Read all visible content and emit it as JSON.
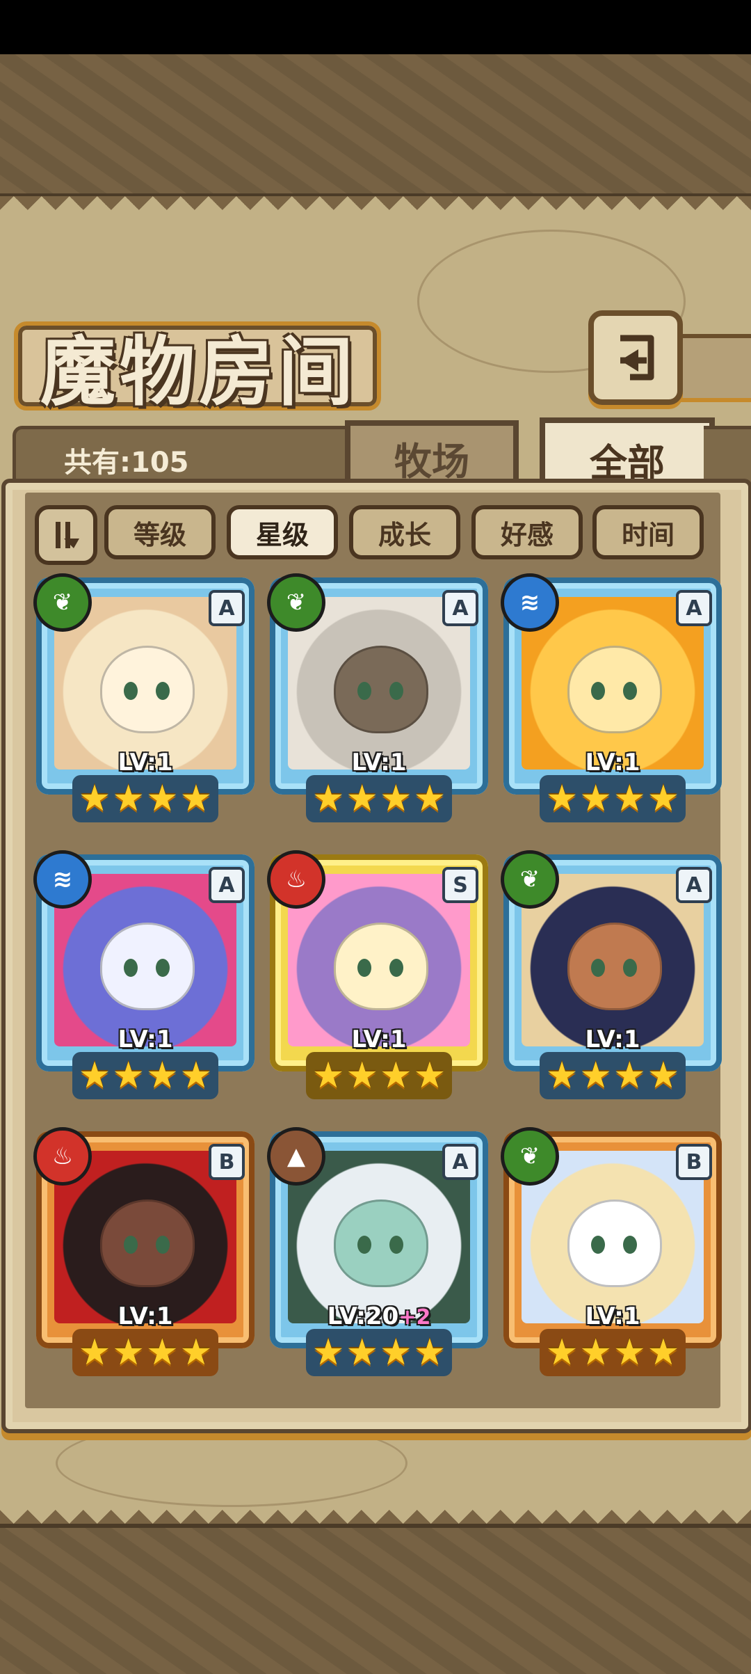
{
  "title": "魔物房间",
  "count_label": "共有:105",
  "tabs": [
    {
      "label": "牧场",
      "active": false
    },
    {
      "label": "全部",
      "active": true
    }
  ],
  "filters": [
    {
      "label": "等级",
      "active": false
    },
    {
      "label": "星级",
      "active": true
    },
    {
      "label": "成长",
      "active": false
    },
    {
      "label": "好感",
      "active": false
    },
    {
      "label": "时间",
      "active": false
    }
  ],
  "sort_toggle_icon": "sort-order-icon",
  "back_icon": "return-arrow-icon",
  "monsters": [
    {
      "element": "grass",
      "rank": "A",
      "level": "LV:1",
      "bonus": "",
      "stars": 4,
      "frame": "blue"
    },
    {
      "element": "grass",
      "rank": "A",
      "level": "LV:1",
      "bonus": "",
      "stars": 4,
      "frame": "blue"
    },
    {
      "element": "water",
      "rank": "A",
      "level": "LV:1",
      "bonus": "",
      "stars": 4,
      "frame": "blue"
    },
    {
      "element": "water",
      "rank": "A",
      "level": "LV:1",
      "bonus": "",
      "stars": 4,
      "frame": "blue"
    },
    {
      "element": "fire",
      "rank": "S",
      "level": "LV:1",
      "bonus": "",
      "stars": 4,
      "frame": "gold"
    },
    {
      "element": "grass",
      "rank": "A",
      "level": "LV:1",
      "bonus": "",
      "stars": 4,
      "frame": "blue"
    },
    {
      "element": "fire",
      "rank": "B",
      "level": "LV:1",
      "bonus": "",
      "stars": 4,
      "frame": "orange"
    },
    {
      "element": "earth",
      "rank": "A",
      "level": "LV:20",
      "bonus": "+2",
      "stars": 4,
      "frame": "blue"
    },
    {
      "element": "grass",
      "rank": "B",
      "level": "LV:1",
      "bonus": "",
      "stars": 4,
      "frame": "orange"
    }
  ],
  "colors": {
    "frame_blue": "#7dc6ea",
    "frame_gold": "#f3d84e",
    "frame_orange": "#e8913a",
    "element_grass": "#3e8a2a",
    "element_water": "#2e7ad0",
    "element_fire": "#d2332a",
    "element_earth": "#8a5536",
    "star": "#ffcf2a",
    "bonus_pink": "#ff78c8"
  }
}
